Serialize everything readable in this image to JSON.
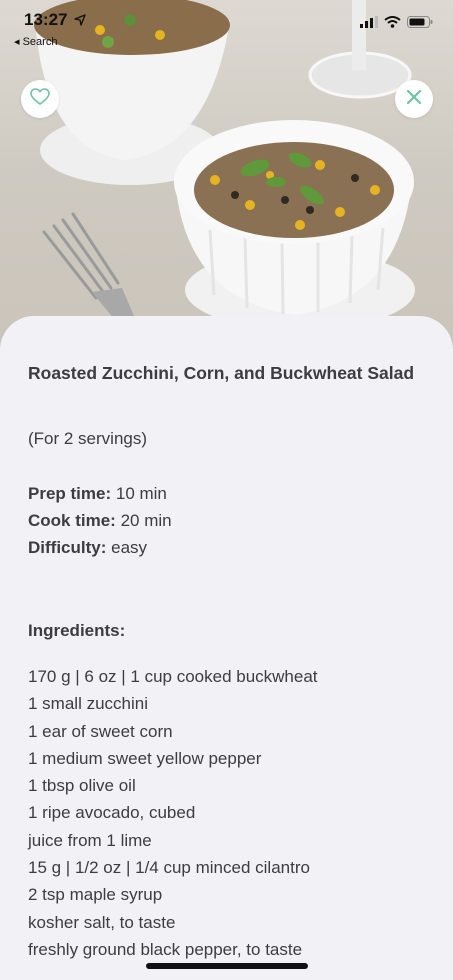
{
  "status_bar": {
    "time": "13:27",
    "back_label": "◂ Search"
  },
  "hero": {
    "image": "roasted-zucchini-corn-buckwheat-salad-photo"
  },
  "actions": {
    "favorite_icon": "heart-icon",
    "close_icon": "close-icon",
    "accent": "#6ec1a7"
  },
  "recipe": {
    "title": "Roasted Zucchini, Corn, and Buckwheat Salad",
    "servings": "(For 2 servings)",
    "prep_label": "Prep time:",
    "prep_value": " 10 min",
    "cook_label": "Cook time:",
    "cook_value": " 20 min",
    "difficulty_label": "Difficulty:",
    "difficulty_value": " easy",
    "ingredients_heading": "Ingredients:",
    "ingredients": [
      "170 g | 6 oz | 1 cup cooked buckwheat",
      "1 small zucchini",
      "1 ear of sweet corn",
      "1 medium sweet yellow pepper",
      "1 tbsp olive oil",
      "1 ripe avocado, cubed",
      "juice from 1 lime",
      "15 g | 1/2 oz | 1/4 cup minced cilantro",
      "2 tsp maple syrup",
      "kosher salt, to taste",
      "freshly ground black pepper, to taste"
    ]
  }
}
